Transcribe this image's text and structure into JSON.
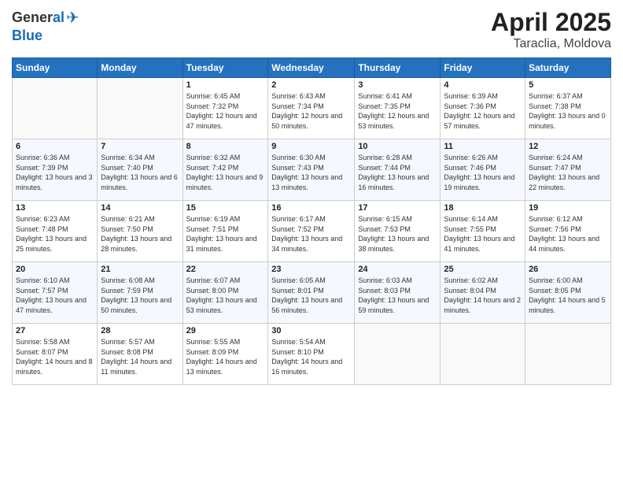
{
  "header": {
    "logo_general": "General",
    "logo_blue": "Blue",
    "title": "April 2025",
    "subtitle": "Taraclia, Moldova"
  },
  "days_of_week": [
    "Sunday",
    "Monday",
    "Tuesday",
    "Wednesday",
    "Thursday",
    "Friday",
    "Saturday"
  ],
  "weeks": [
    [
      {
        "day": "",
        "detail": ""
      },
      {
        "day": "",
        "detail": ""
      },
      {
        "day": "1",
        "detail": "Sunrise: 6:45 AM\nSunset: 7:32 PM\nDaylight: 12 hours and 47 minutes."
      },
      {
        "day": "2",
        "detail": "Sunrise: 6:43 AM\nSunset: 7:34 PM\nDaylight: 12 hours and 50 minutes."
      },
      {
        "day": "3",
        "detail": "Sunrise: 6:41 AM\nSunset: 7:35 PM\nDaylight: 12 hours and 53 minutes."
      },
      {
        "day": "4",
        "detail": "Sunrise: 6:39 AM\nSunset: 7:36 PM\nDaylight: 12 hours and 57 minutes."
      },
      {
        "day": "5",
        "detail": "Sunrise: 6:37 AM\nSunset: 7:38 PM\nDaylight: 13 hours and 0 minutes."
      }
    ],
    [
      {
        "day": "6",
        "detail": "Sunrise: 6:36 AM\nSunset: 7:39 PM\nDaylight: 13 hours and 3 minutes."
      },
      {
        "day": "7",
        "detail": "Sunrise: 6:34 AM\nSunset: 7:40 PM\nDaylight: 13 hours and 6 minutes."
      },
      {
        "day": "8",
        "detail": "Sunrise: 6:32 AM\nSunset: 7:42 PM\nDaylight: 13 hours and 9 minutes."
      },
      {
        "day": "9",
        "detail": "Sunrise: 6:30 AM\nSunset: 7:43 PM\nDaylight: 13 hours and 13 minutes."
      },
      {
        "day": "10",
        "detail": "Sunrise: 6:28 AM\nSunset: 7:44 PM\nDaylight: 13 hours and 16 minutes."
      },
      {
        "day": "11",
        "detail": "Sunrise: 6:26 AM\nSunset: 7:46 PM\nDaylight: 13 hours and 19 minutes."
      },
      {
        "day": "12",
        "detail": "Sunrise: 6:24 AM\nSunset: 7:47 PM\nDaylight: 13 hours and 22 minutes."
      }
    ],
    [
      {
        "day": "13",
        "detail": "Sunrise: 6:23 AM\nSunset: 7:48 PM\nDaylight: 13 hours and 25 minutes."
      },
      {
        "day": "14",
        "detail": "Sunrise: 6:21 AM\nSunset: 7:50 PM\nDaylight: 13 hours and 28 minutes."
      },
      {
        "day": "15",
        "detail": "Sunrise: 6:19 AM\nSunset: 7:51 PM\nDaylight: 13 hours and 31 minutes."
      },
      {
        "day": "16",
        "detail": "Sunrise: 6:17 AM\nSunset: 7:52 PM\nDaylight: 13 hours and 34 minutes."
      },
      {
        "day": "17",
        "detail": "Sunrise: 6:15 AM\nSunset: 7:53 PM\nDaylight: 13 hours and 38 minutes."
      },
      {
        "day": "18",
        "detail": "Sunrise: 6:14 AM\nSunset: 7:55 PM\nDaylight: 13 hours and 41 minutes."
      },
      {
        "day": "19",
        "detail": "Sunrise: 6:12 AM\nSunset: 7:56 PM\nDaylight: 13 hours and 44 minutes."
      }
    ],
    [
      {
        "day": "20",
        "detail": "Sunrise: 6:10 AM\nSunset: 7:57 PM\nDaylight: 13 hours and 47 minutes."
      },
      {
        "day": "21",
        "detail": "Sunrise: 6:08 AM\nSunset: 7:59 PM\nDaylight: 13 hours and 50 minutes."
      },
      {
        "day": "22",
        "detail": "Sunrise: 6:07 AM\nSunset: 8:00 PM\nDaylight: 13 hours and 53 minutes."
      },
      {
        "day": "23",
        "detail": "Sunrise: 6:05 AM\nSunset: 8:01 PM\nDaylight: 13 hours and 56 minutes."
      },
      {
        "day": "24",
        "detail": "Sunrise: 6:03 AM\nSunset: 8:03 PM\nDaylight: 13 hours and 59 minutes."
      },
      {
        "day": "25",
        "detail": "Sunrise: 6:02 AM\nSunset: 8:04 PM\nDaylight: 14 hours and 2 minutes."
      },
      {
        "day": "26",
        "detail": "Sunrise: 6:00 AM\nSunset: 8:05 PM\nDaylight: 14 hours and 5 minutes."
      }
    ],
    [
      {
        "day": "27",
        "detail": "Sunrise: 5:58 AM\nSunset: 8:07 PM\nDaylight: 14 hours and 8 minutes."
      },
      {
        "day": "28",
        "detail": "Sunrise: 5:57 AM\nSunset: 8:08 PM\nDaylight: 14 hours and 11 minutes."
      },
      {
        "day": "29",
        "detail": "Sunrise: 5:55 AM\nSunset: 8:09 PM\nDaylight: 14 hours and 13 minutes."
      },
      {
        "day": "30",
        "detail": "Sunrise: 5:54 AM\nSunset: 8:10 PM\nDaylight: 14 hours and 16 minutes."
      },
      {
        "day": "",
        "detail": ""
      },
      {
        "day": "",
        "detail": ""
      },
      {
        "day": "",
        "detail": ""
      }
    ]
  ]
}
